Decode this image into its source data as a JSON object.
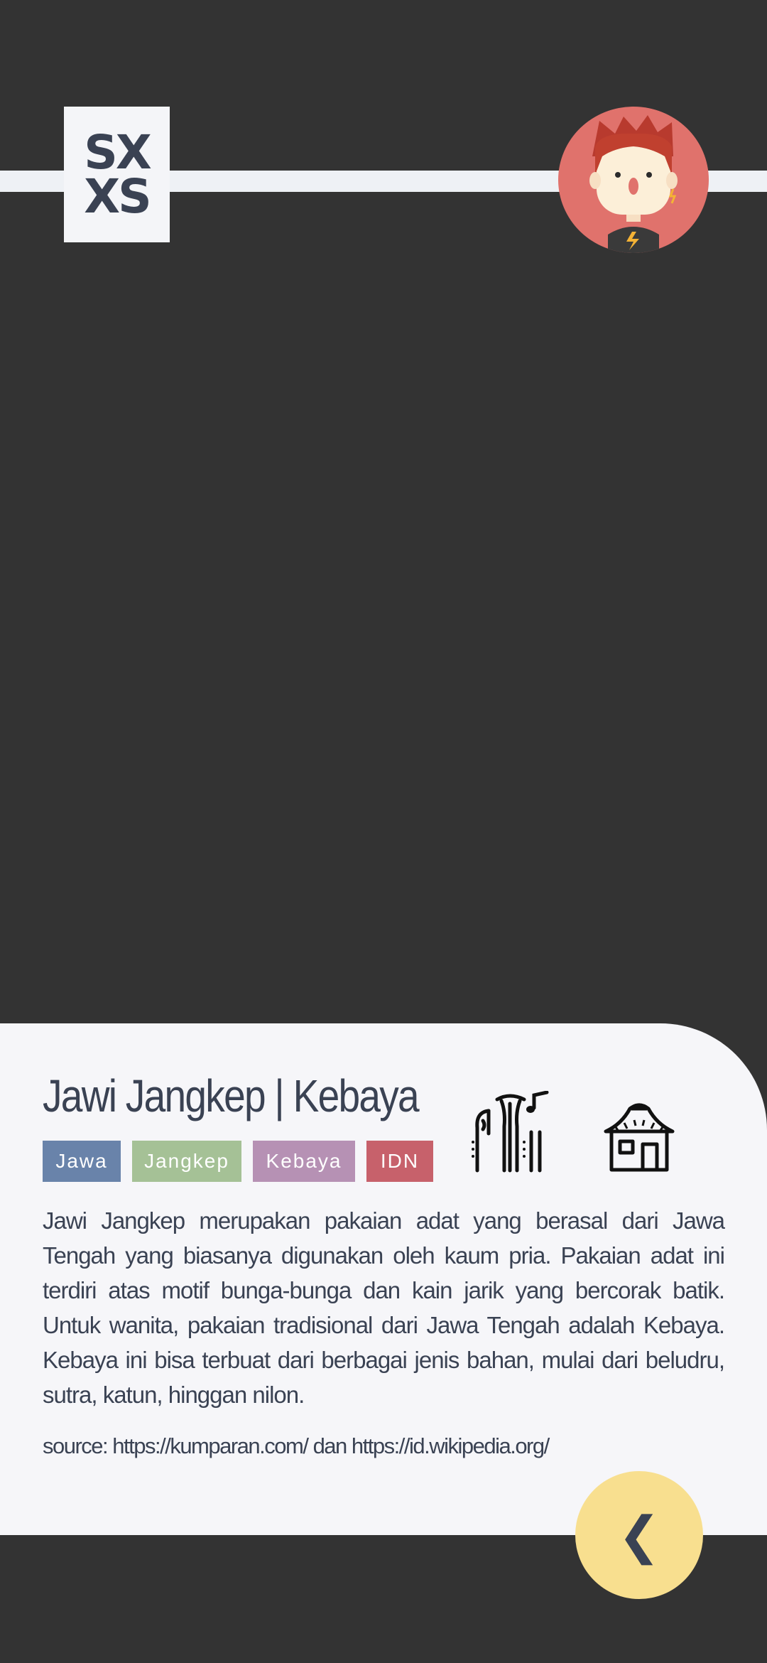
{
  "header": {
    "logo": {
      "line1": "SX",
      "line2": "XS"
    },
    "avatar_icon": "cartoon-avatar"
  },
  "article": {
    "title": "Jawi Jangkep | Kebaya",
    "tags": [
      {
        "label": "Jawa",
        "color": "#6983aa"
      },
      {
        "label": "Jangkep",
        "color": "#a5c196"
      },
      {
        "label": "Kebaya",
        "color": "#b691b4"
      },
      {
        "label": "IDN",
        "color": "#c7616b"
      }
    ],
    "icons": [
      "traditional-music-instruments-icon",
      "traditional-house-icon"
    ],
    "description": "Jawi Jangkep merupakan pakaian adat yang berasal dari Jawa Tengah yang biasanya digunakan oleh kaum pria. Pakaian adat ini terdiri atas motif bunga-bunga dan kain jarik yang bercorak batik. Untuk wanita, pakaian tradisional dari Jawa Tengah adalah Kebaya. Kebaya ini bisa terbuat dari berbagai jenis bahan, mulai dari beludru, sutra, katun, hinggan nilon.",
    "source": "source: https://kumparan.com/ dan https://id.wikipedia.org/"
  },
  "back_button": {
    "label": "❮",
    "color": "#f8df8f"
  },
  "colors": {
    "background": "#333333",
    "panel": "#f6f6f9",
    "text": "#3a4253",
    "stripe": "#eef1f5"
  }
}
